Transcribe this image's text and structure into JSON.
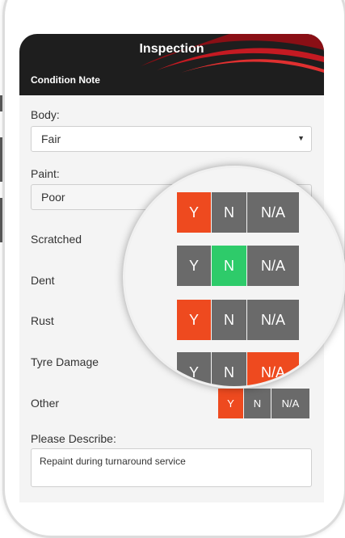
{
  "header": {
    "title": "Inspection",
    "subtitle": "Condition Note"
  },
  "fields": {
    "body": {
      "label": "Body:",
      "value": "Fair"
    },
    "paint": {
      "label": "Paint:",
      "value": "Poor"
    }
  },
  "segments": {
    "yes": "Y",
    "no": "N",
    "na": "N/A"
  },
  "checks": [
    {
      "label": "Scratched",
      "selected": "N"
    },
    {
      "label": "Dent",
      "selected": "N"
    },
    {
      "label": "Rust",
      "selected": "Y"
    },
    {
      "label": "Tyre Damage",
      "selected": "N/A"
    },
    {
      "label": "Other",
      "selected": "Y"
    }
  ],
  "describe": {
    "label": "Please Describe:",
    "value": "Repaint during turnaround service"
  },
  "colors": {
    "yes": "#ee4a1f",
    "no_selected": "#2ecb6a",
    "unselected": "#6a6a6a",
    "header": "#1e1e1e"
  }
}
